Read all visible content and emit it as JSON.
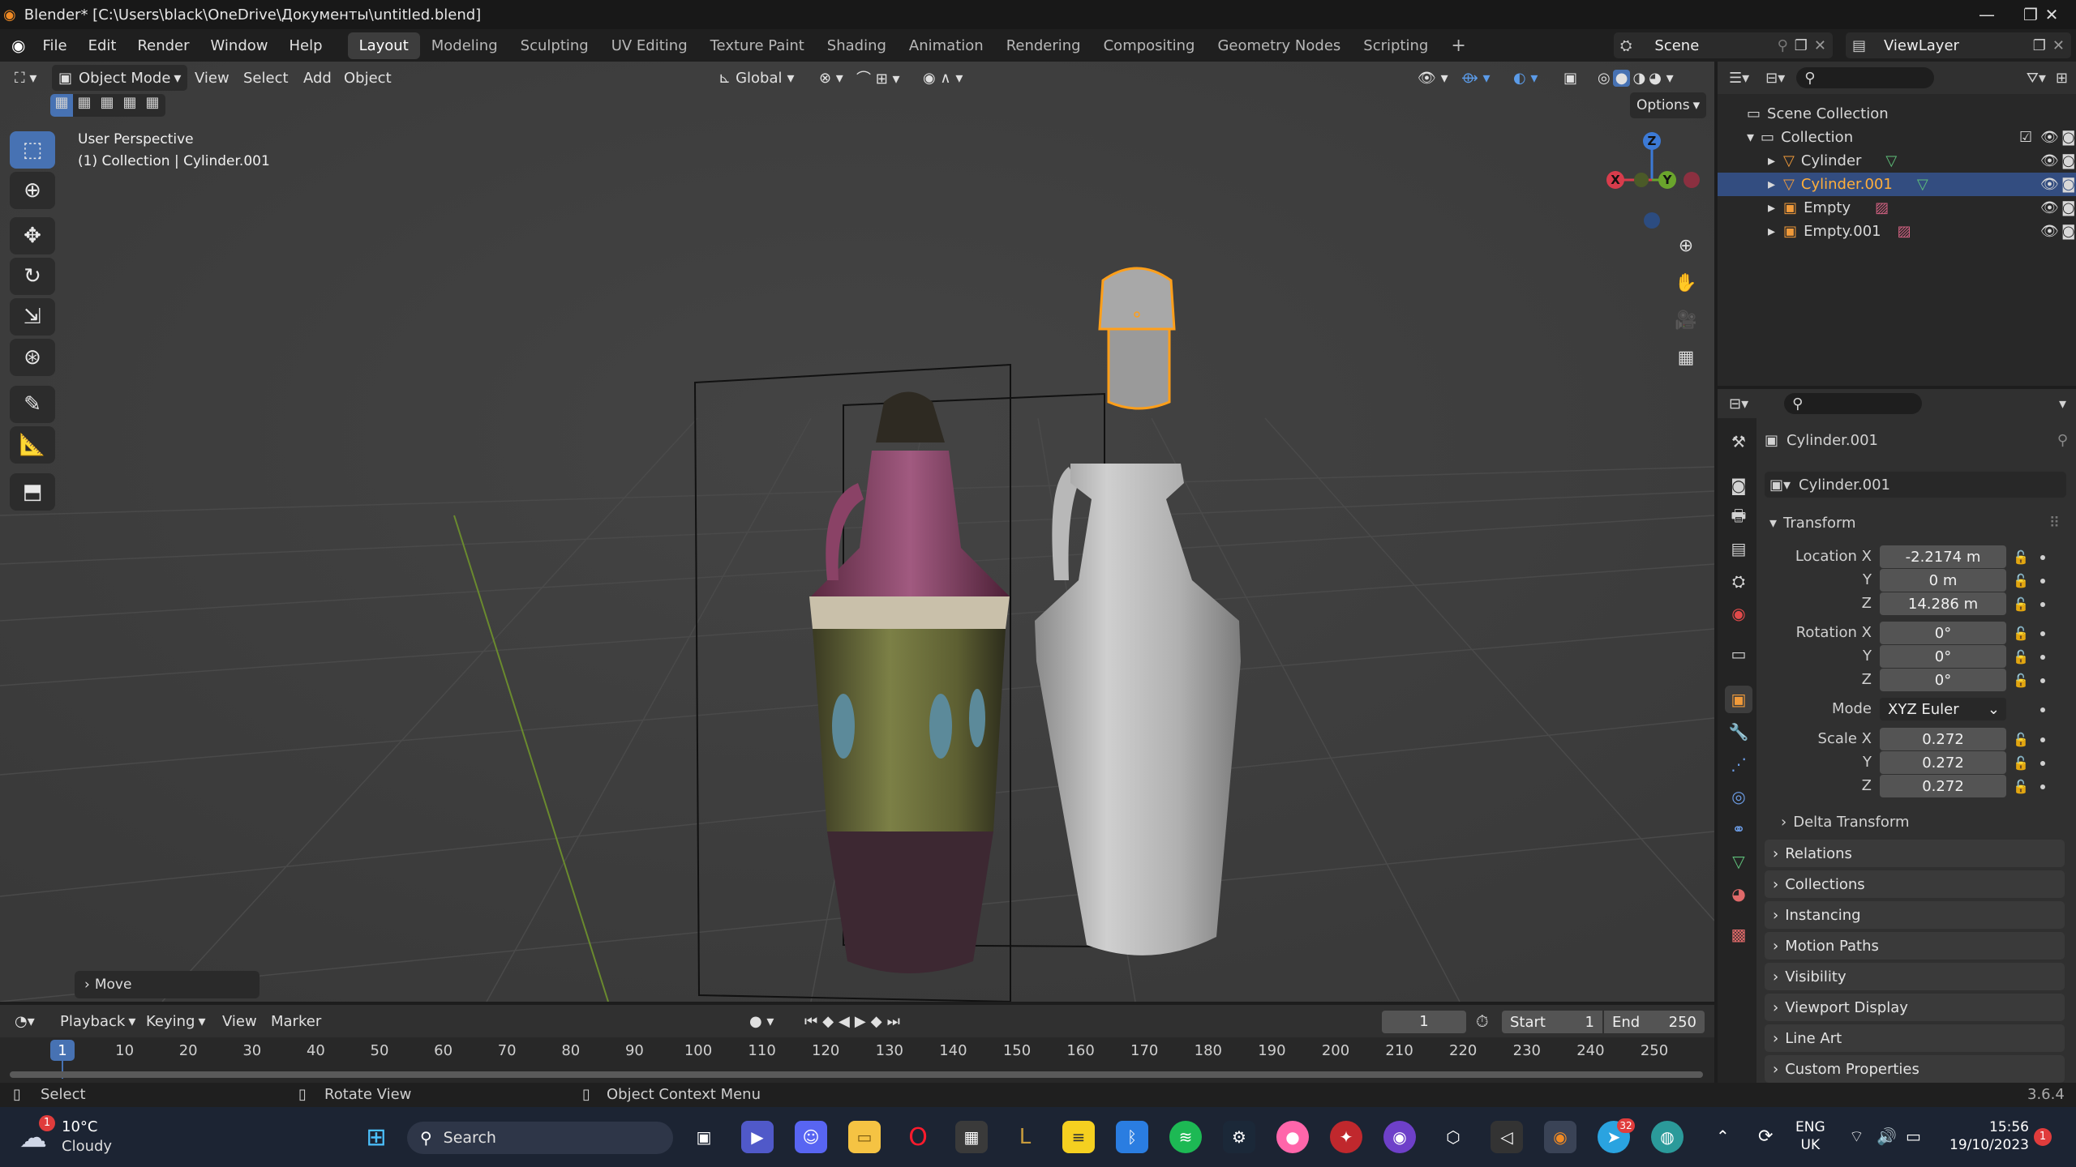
{
  "titlebar": {
    "title": "Blender* [C:\\Users\\black\\OneDrive\\Документы\\untitled.blend]"
  },
  "menus": [
    "File",
    "Edit",
    "Render",
    "Window",
    "Help"
  ],
  "workspaces": [
    "Layout",
    "Modeling",
    "Sculpting",
    "UV Editing",
    "Texture Paint",
    "Shading",
    "Animation",
    "Rendering",
    "Compositing",
    "Geometry Nodes",
    "Scripting"
  ],
  "active_workspace": "Layout",
  "scene": {
    "scene_name": "Scene",
    "viewlayer_name": "ViewLayer"
  },
  "viewport": {
    "mode": "Object Mode",
    "header_menus": [
      "View",
      "Select",
      "Add",
      "Object"
    ],
    "orientation": "Global",
    "options_label": "Options",
    "overlay_line1": "User Perspective",
    "overlay_line2": "(1) Collection | Cylinder.001",
    "last_op": "Move",
    "gizmo": {
      "x": "X",
      "y": "Y",
      "z": "Z"
    }
  },
  "outliner": {
    "root": "Scene Collection",
    "collection": "Collection",
    "items": [
      {
        "name": "Cylinder",
        "selected": false
      },
      {
        "name": "Cylinder.001",
        "selected": true
      },
      {
        "name": "Empty",
        "selected": false
      },
      {
        "name": "Empty.001",
        "selected": false
      }
    ]
  },
  "properties": {
    "object_name": "Cylinder.001",
    "data_name": "Cylinder.001",
    "transform_title": "Transform",
    "location_label": "Location X",
    "rotation_label": "Rotation X",
    "scale_label": "Scale X",
    "axis_y": "Y",
    "axis_z": "Z",
    "mode_label": "Mode",
    "location": {
      "x": "-2.2174 m",
      "y": "0 m",
      "z": "14.286 m"
    },
    "rotation": {
      "x": "0°",
      "y": "0°",
      "z": "0°"
    },
    "rotation_mode": "XYZ Euler",
    "scale": {
      "x": "0.272",
      "y": "0.272",
      "z": "0.272"
    },
    "panels": [
      "Delta Transform",
      "Relations",
      "Collections",
      "Instancing",
      "Motion Paths",
      "Visibility",
      "Viewport Display",
      "Line Art",
      "Custom Properties"
    ]
  },
  "timeline": {
    "menus": [
      "Playback",
      "Keying",
      "View",
      "Marker"
    ],
    "current_frame": "1",
    "start_label": "Start",
    "start": "1",
    "end_label": "End",
    "end": "250",
    "ticks": [
      "1",
      "10",
      "20",
      "30",
      "40",
      "50",
      "60",
      "70",
      "80",
      "90",
      "100",
      "110",
      "120",
      "130",
      "140",
      "150",
      "160",
      "170",
      "180",
      "190",
      "200",
      "210",
      "220",
      "230",
      "240",
      "250"
    ]
  },
  "statusbar": {
    "select": "Select",
    "rotate": "Rotate View",
    "context": "Object Context Menu",
    "version": "3.6.4"
  },
  "taskbar": {
    "temperature": "10°C",
    "weather": "Cloudy",
    "weather_badge": "1",
    "search": "Search",
    "lang1": "ENG",
    "lang2": "UK",
    "time": "15:56",
    "date": "19/10/2023",
    "telegram_badge": "32",
    "notif_badge": "1"
  },
  "colors": {
    "accent": "#4772b3",
    "selection": "#ff9f1a",
    "header": "#1f1f1f",
    "viewport": "#3d3d3d"
  }
}
